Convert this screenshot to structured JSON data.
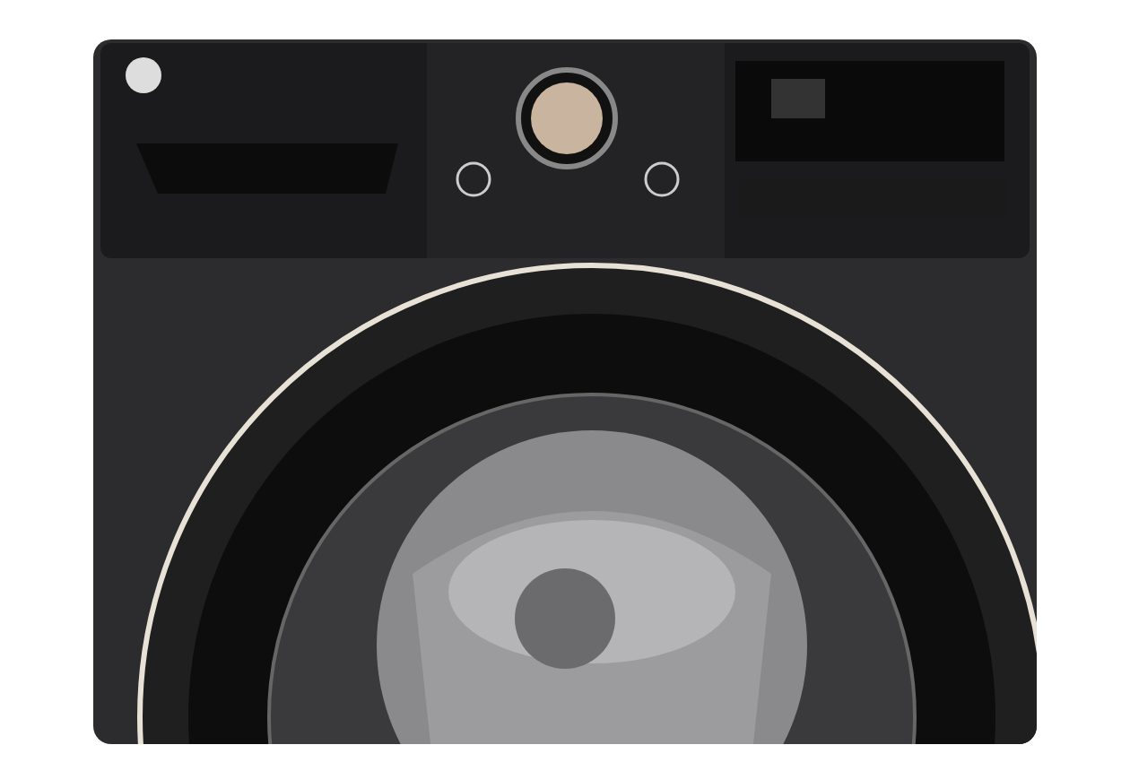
{
  "scene": {
    "kind": "photo"
  }
}
